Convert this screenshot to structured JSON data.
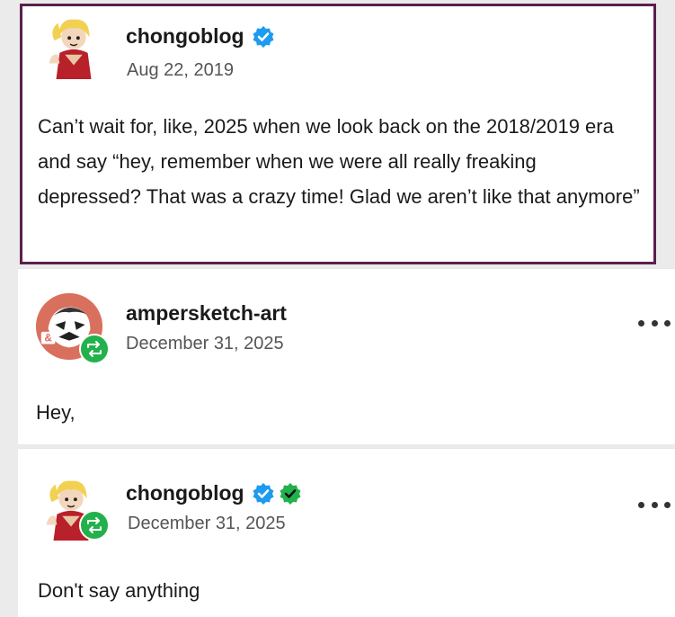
{
  "posts": [
    {
      "username": "chongoblog",
      "date": "Aug 22, 2019",
      "body": "Can’t wait for, like, 2025 when we look back on the 2018/2019 era and say “hey, remember when we were all really freaking depressed? That was a crazy time! Glad we aren’t like that anymore”",
      "badges": [
        "verified-check-blue"
      ]
    },
    {
      "username": "ampersketch-art",
      "date": "December 31, 2025",
      "body": "Hey,",
      "avatar_letter": "&",
      "badges": [
        "reblog-green"
      ]
    },
    {
      "username": "chongoblog",
      "date": "December 31, 2025",
      "body": "Don't say anything",
      "badges": [
        "verified-check-blue",
        "verified-check-green",
        "reblog-green"
      ]
    }
  ],
  "colors": {
    "highlight_border": "#5a1f4e",
    "verified_blue": "#1d9bf0",
    "verified_green": "#22b14c",
    "reblog_green": "#22b14c"
  },
  "icons": [
    "avatar-chongo-icon",
    "avatar-ampersketch-icon",
    "verified-badge-icon",
    "reblog-icon",
    "more-options-icon"
  ]
}
